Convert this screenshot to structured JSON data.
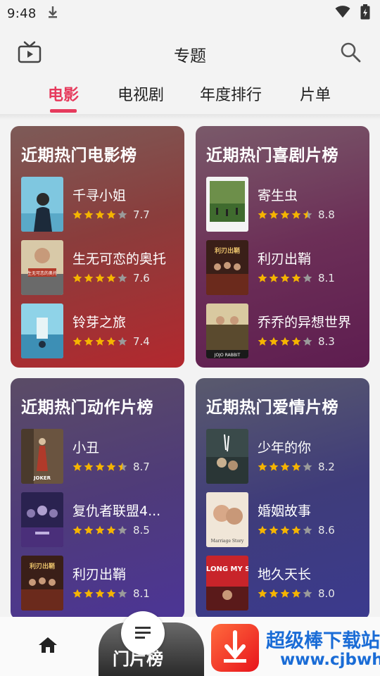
{
  "status": {
    "time": "9:48"
  },
  "header": {
    "title": "专题"
  },
  "tabs": [
    {
      "label": "电影",
      "active": true
    },
    {
      "label": "电视剧",
      "active": false
    },
    {
      "label": "年度排行",
      "active": false
    },
    {
      "label": "片单",
      "active": false
    }
  ],
  "cards": [
    {
      "title": "近期热门电影榜",
      "items": [
        {
          "name": "千寻小姐",
          "rating": "7.7",
          "stars": 4
        },
        {
          "name": "生无可恋的奥托",
          "rating": "7.6",
          "stars": 4
        },
        {
          "name": "铃芽之旅",
          "rating": "7.4",
          "stars": 4
        }
      ]
    },
    {
      "title": "近期热门喜剧片榜",
      "items": [
        {
          "name": "寄生虫",
          "rating": "8.8",
          "stars": 4.5
        },
        {
          "name": "利刃出鞘",
          "rating": "8.1",
          "stars": 4
        },
        {
          "name": "乔乔的异想世界",
          "rating": "8.3",
          "stars": 4
        }
      ]
    },
    {
      "title": "近期热门动作片榜",
      "items": [
        {
          "name": "小丑",
          "rating": "8.7",
          "stars": 4.5
        },
        {
          "name": "复仇者联盟4...",
          "rating": "8.5",
          "stars": 4
        },
        {
          "name": "利刃出鞘",
          "rating": "8.1",
          "stars": 4
        }
      ]
    },
    {
      "title": "近期热门爱情片榜",
      "items": [
        {
          "name": "少年的你",
          "rating": "8.2",
          "stars": 4
        },
        {
          "name": "婚姻故事",
          "rating": "8.6",
          "stars": 4
        },
        {
          "name": "地久天长",
          "rating": "8.0",
          "stars": 4
        }
      ]
    }
  ],
  "poster_texts": {
    "p2_1": "生无可恋的奥托",
    "p2_2": "利刃出鞘",
    "p2_3": "JOJO RABBIT",
    "p3_1": "JOKER",
    "p3_3": "利刃出鞘",
    "p4_2": "Marriage Story",
    "p4_3": "SO LONG MY SON"
  },
  "bottom_nav": {
    "partial_label": "门片榜"
  },
  "watermark": {
    "title": "超级棒下载站",
    "url": "www.cjbwh.com"
  },
  "colors": {
    "accent": "#e63a5c",
    "star": "#f5b400",
    "star_empty": "#9a9a9a"
  },
  "icons": [
    "download-icon",
    "wifi-icon",
    "battery-icon",
    "tv-icon",
    "search-icon",
    "home-icon",
    "list-icon"
  ]
}
